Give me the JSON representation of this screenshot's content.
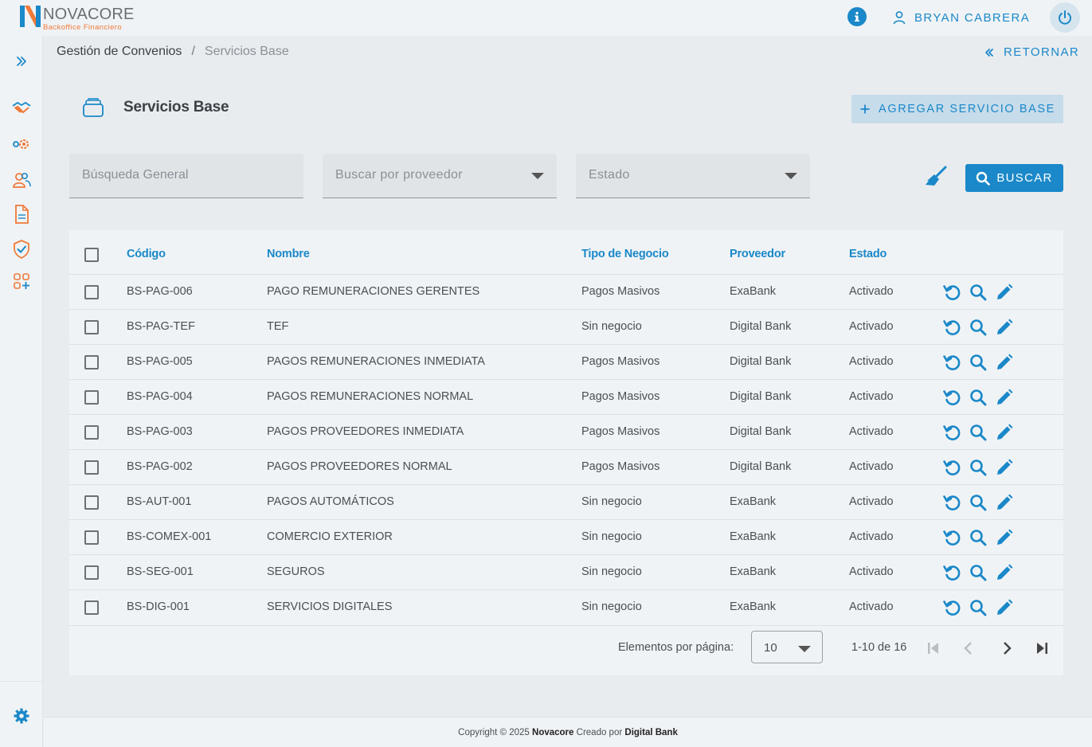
{
  "brand": {
    "name": "NOVACORE",
    "subtitle": "Backoffice Financiero",
    "accent": "#1a88c9",
    "secondary": "#ef7a3a"
  },
  "header": {
    "info_icon": "info-icon",
    "user_name": "BRYAN CABRERA",
    "user_icon": "user-icon",
    "power_icon": "power-icon"
  },
  "sidebar": {
    "items": [
      {
        "icon": "expand-icon"
      },
      {
        "icon": "handshake-icon"
      },
      {
        "icon": "gears-icon"
      },
      {
        "icon": "users-icon"
      },
      {
        "icon": "document-icon"
      },
      {
        "icon": "shield-check-icon"
      },
      {
        "icon": "apps-add-icon"
      },
      {
        "icon": "settings-icon"
      }
    ]
  },
  "breadcrumb": {
    "parent": "Gestión de Convenios",
    "separator": "/",
    "current": "Servicios Base"
  },
  "return_label": "RETORNAR",
  "page": {
    "title": "Servicios Base",
    "add_button": "AGREGAR SERVICIO BASE"
  },
  "filters": {
    "general_placeholder": "Búsqueda General",
    "provider_placeholder": "Buscar por proveedor",
    "status_placeholder": "Estado",
    "search_button": "BUSCAR"
  },
  "table": {
    "columns": [
      "Código",
      "Nombre",
      "Tipo de Negocio",
      "Proveedor",
      "Estado"
    ],
    "rows": [
      {
        "code": "BS-PAG-006",
        "name": "PAGO REMUNERACIONES GERENTES",
        "type": "Pagos Masivos",
        "provider": "ExaBank",
        "status": "Activado"
      },
      {
        "code": "BS-PAG-TEF",
        "name": "TEF",
        "type": "Sin negocio",
        "provider": "Digital Bank",
        "status": "Activado"
      },
      {
        "code": "BS-PAG-005",
        "name": "PAGOS REMUNERACIONES INMEDIATA",
        "type": "Pagos Masivos",
        "provider": "Digital Bank",
        "status": "Activado"
      },
      {
        "code": "BS-PAG-004",
        "name": "PAGOS REMUNERACIONES NORMAL",
        "type": "Pagos Masivos",
        "provider": "Digital Bank",
        "status": "Activado"
      },
      {
        "code": "BS-PAG-003",
        "name": "PAGOS PROVEEDORES INMEDIATA",
        "type": "Pagos Masivos",
        "provider": "Digital Bank",
        "status": "Activado"
      },
      {
        "code": "BS-PAG-002",
        "name": "PAGOS PROVEEDORES NORMAL",
        "type": "Pagos Masivos",
        "provider": "Digital Bank",
        "status": "Activado"
      },
      {
        "code": "BS-AUT-001",
        "name": "PAGOS AUTOMÁTICOS",
        "type": "Sin negocio",
        "provider": "ExaBank",
        "status": "Activado"
      },
      {
        "code": "BS-COMEX-001",
        "name": "COMERCIO EXTERIOR",
        "type": "Sin negocio",
        "provider": "ExaBank",
        "status": "Activado"
      },
      {
        "code": "BS-SEG-001",
        "name": "SEGUROS",
        "type": "Sin negocio",
        "provider": "ExaBank",
        "status": "Activado"
      },
      {
        "code": "BS-DIG-001",
        "name": "SERVICIOS DIGITALES",
        "type": "Sin negocio",
        "provider": "ExaBank",
        "status": "Activado"
      }
    ]
  },
  "pagination": {
    "label": "Elementos por página:",
    "page_size": "10",
    "range": "1-10 de 16"
  },
  "footer": {
    "prefix": "Copyright © 2025",
    "brand": "Novacore",
    "middle": "Creado por",
    "company": "Digital Bank"
  }
}
